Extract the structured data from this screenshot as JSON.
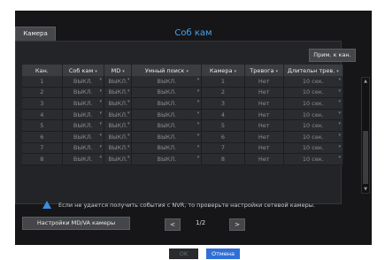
{
  "dialog": {
    "title": "Соб кам",
    "tab_camera": "Камера",
    "copy_button": "Прим. к кан."
  },
  "table": {
    "headers": [
      "Кан.",
      "Соб кам",
      "MD",
      "Умный поиск",
      "Камера",
      "Тревога",
      "Длительн трев."
    ],
    "rows": [
      [
        "1",
        "ВЫКЛ.",
        "ВЫКЛ.",
        "ВЫКЛ.",
        "1",
        "Нет",
        "10 сек."
      ],
      [
        "2",
        "ВЫКЛ.",
        "ВЫКЛ.",
        "ВЫКЛ.",
        "2",
        "Нет",
        "10 сек."
      ],
      [
        "3",
        "ВЫКЛ.",
        "ВЫКЛ.",
        "ВЫКЛ.",
        "3",
        "Нет",
        "10 сек."
      ],
      [
        "4",
        "ВЫКЛ.",
        "ВЫКЛ.",
        "ВЫКЛ.",
        "4",
        "Нет",
        "10 сек."
      ],
      [
        "5",
        "ВЫКЛ.",
        "ВЫКЛ.",
        "ВЫКЛ.",
        "5",
        "Нет",
        "10 сек."
      ],
      [
        "6",
        "ВЫКЛ.",
        "ВЫКЛ.",
        "ВЫКЛ.",
        "6",
        "Нет",
        "10 сек."
      ],
      [
        "7",
        "ВЫКЛ.",
        "ВЫКЛ.",
        "ВЫКЛ.",
        "7",
        "Нет",
        "10 сек."
      ],
      [
        "8",
        "ВЫКЛ.",
        "ВЫКЛ.",
        "ВЫКЛ.",
        "8",
        "Нет",
        "10 сек."
      ]
    ]
  },
  "warning_text": "Если не удается получить события с NVR, то проверьте настройки сетевой камеры.",
  "md_va_button": "Настройки MD/VA камеры",
  "pagination": {
    "prev": "<",
    "page": "1/2",
    "next": ">"
  },
  "footer": {
    "ok": "OK",
    "cancel": "Отмена"
  },
  "colors": {
    "accent": "#2f6fd6",
    "title": "#4aa3e8",
    "warning_icon": "#3d8be0"
  }
}
